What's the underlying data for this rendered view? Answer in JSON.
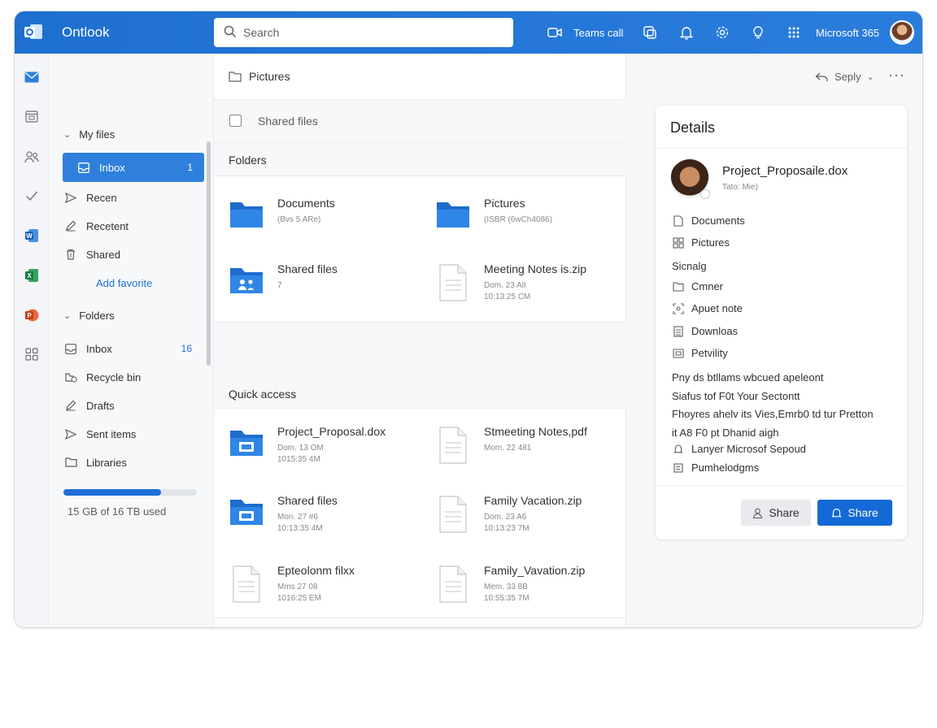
{
  "app": {
    "title": "Ontlook"
  },
  "search": {
    "placeholder": "Search"
  },
  "header": {
    "teams_call": "Teams call",
    "brand": "Microsoft 365"
  },
  "folder_pane": {
    "my_files_label": "My files",
    "my_files_items": [
      {
        "label": "Inbox",
        "count": "1",
        "icon": "inbox-icon",
        "selected": true
      },
      {
        "label": "Recen",
        "icon": "send-icon"
      },
      {
        "label": "Recetent",
        "icon": "pencil-icon"
      },
      {
        "label": "Shared",
        "icon": "trash-icon"
      }
    ],
    "add_favorite": "Add favorite",
    "folders_label": "Folders",
    "folder_items": [
      {
        "label": "Inbox",
        "count": "16",
        "icon": "inbox-icon"
      },
      {
        "label": "Recycle bin",
        "icon": "recycle-icon"
      },
      {
        "label": "Drafts",
        "icon": "pencil-icon"
      },
      {
        "label": "Sent items",
        "icon": "send-icon"
      },
      {
        "label": "Libraries",
        "icon": "folder-icon"
      }
    ],
    "storage": {
      "label": "15 GB of 16 TB used",
      "fraction": 0.73
    }
  },
  "center": {
    "breadcrumb": "Pictures",
    "shared_files": "Shared files",
    "folders_header": "Folders",
    "folders": [
      {
        "name": "Documents",
        "m1": "(Bvs 5 ARe)",
        "m2": "",
        "icon": "folder-icon"
      },
      {
        "name": "Pictures",
        "m1": "(ISBR (6wCh4086)",
        "m2": "",
        "icon": "folder-icon"
      },
      {
        "name": "Shared files",
        "m1": "7",
        "m2": "",
        "icon": "shared-folder-icon"
      },
      {
        "name": "Meeting Notes is.zip",
        "m1": "Dom. 23 AlI",
        "m2": "10:13:25 CM",
        "icon": "document-icon"
      }
    ],
    "quick_access_header": "Quick access",
    "quick_access": [
      {
        "name": "Project_Proposal.dox",
        "m1": "Dom. 13 OM",
        "m2": "1015:35 4M",
        "icon": "folder-doc-icon"
      },
      {
        "name": "Stmeeting Notes,pdf",
        "m1": "Mom. 22 481",
        "m2": "",
        "icon": "document-icon"
      },
      {
        "name": "Shared files",
        "m1": "Mon. 27 #6",
        "m2": "10:13:35 4M",
        "icon": "folder-doc-icon"
      },
      {
        "name": "Family Vacation.zip",
        "m1": "Dom. 23 A6",
        "m2": "10:13:23 7M",
        "icon": "document-icon"
      },
      {
        "name": "Epteolonm filxx",
        "m1": "Mms 27 08",
        "m2": "1016:25 EM",
        "icon": "document-icon"
      },
      {
        "name": "Family_Vavation.zip",
        "m1": "Mem. 33 8B",
        "m2": "10:55:35 7M",
        "icon": "document-icon"
      }
    ]
  },
  "right": {
    "reply_label": "Seply",
    "more_label": "···",
    "details": {
      "title": "Details",
      "file_name": "Project_Proposaile.dox",
      "file_sub": "Tato: Mie)",
      "rows": [
        {
          "label": "Documents",
          "icon": "document-icon"
        },
        {
          "label": "Pictures",
          "icon": "pictures-icon"
        }
      ],
      "signing": "Sicnalg",
      "rows2": [
        {
          "label": "Cmner",
          "icon": "folder-icon"
        },
        {
          "label": "Apuet note",
          "icon": "note-icon"
        },
        {
          "label": "Downloas",
          "icon": "list-icon"
        },
        {
          "label": "Petvility",
          "icon": "calendar-icon"
        }
      ],
      "lines": [
        "Pny ds btllams wbcued apeleont",
        "Siafus tof F0t Your Sectontt",
        "Fhoyres ahelv its Vies,Emrb0 td tur Pretton",
        "it A8 F0 pt Dhanid aigh"
      ],
      "rows3": [
        {
          "label": "Lanyer Microsof Sepoud",
          "icon": "bell-icon"
        },
        {
          "label": "Pumhelodgms",
          "icon": "table-icon"
        }
      ],
      "share_ghost": "Share",
      "share_primary": "Share"
    }
  },
  "colors": {
    "header": "#2476d7",
    "accent": "#1469d6",
    "selected": "#2f80dd",
    "folder": "#2a7bdc"
  }
}
